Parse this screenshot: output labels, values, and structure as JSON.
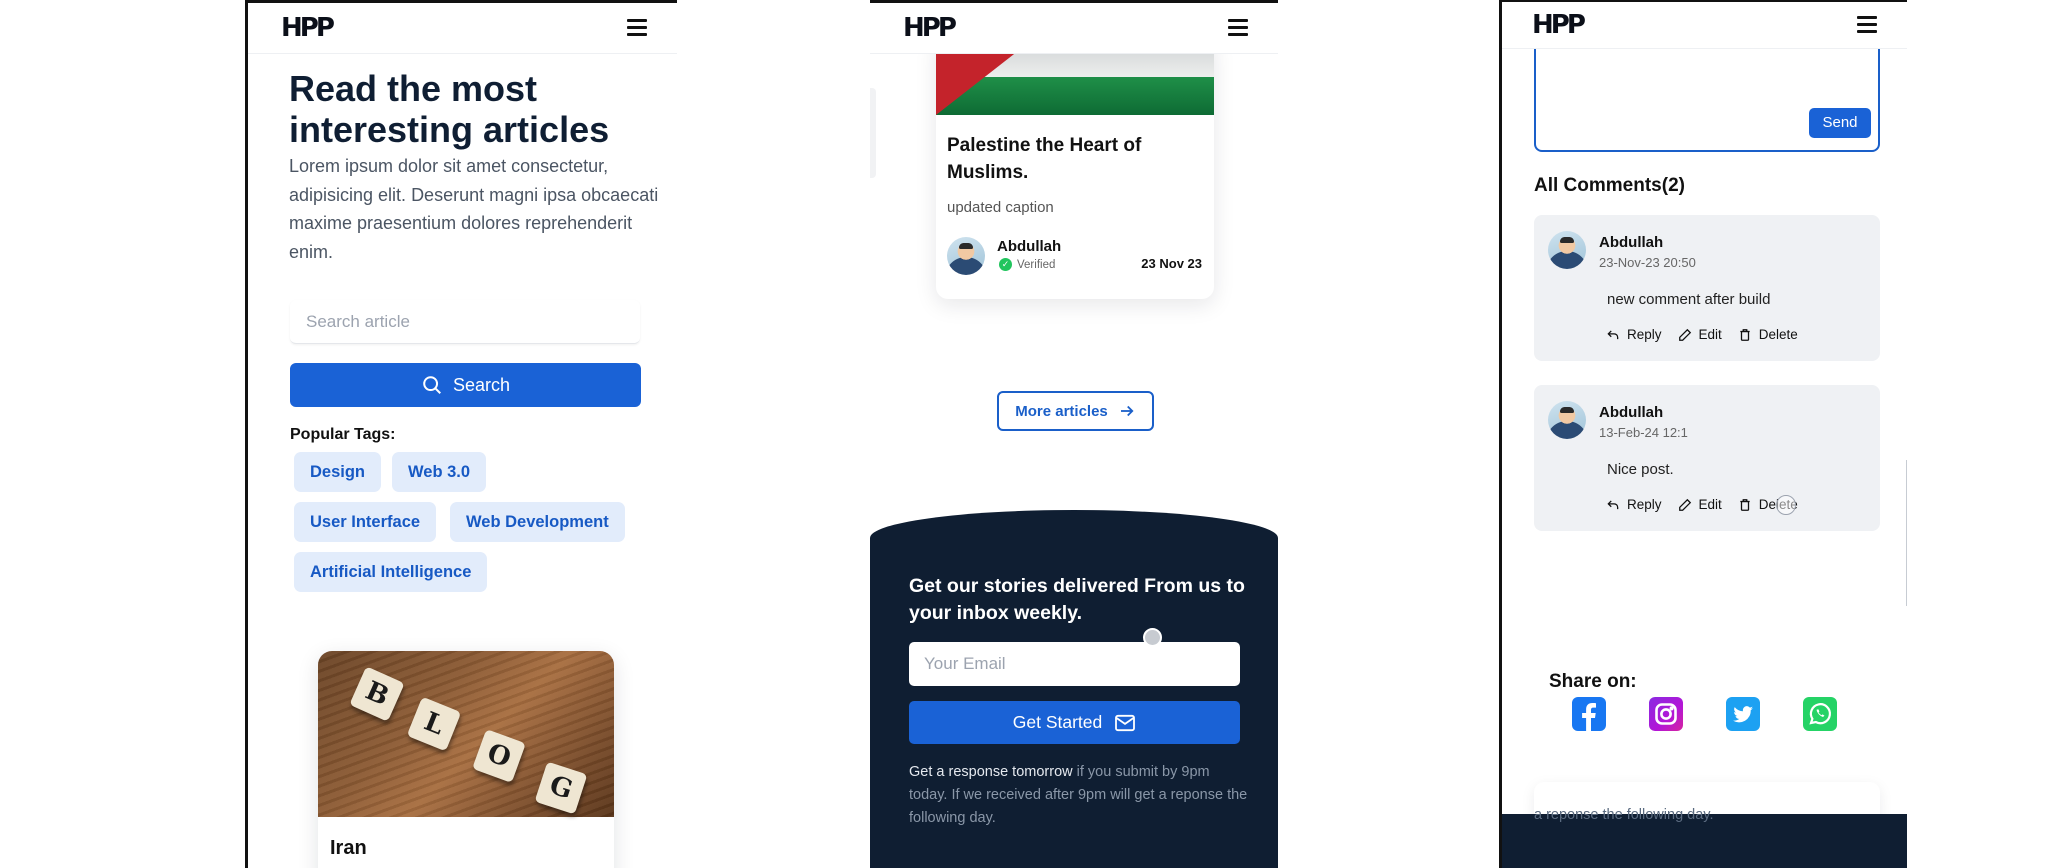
{
  "brand": {
    "logo": "HPP"
  },
  "screen1": {
    "hero_title": "Read the most interesting articles",
    "hero_subtitle": "Lorem ipsum dolor sit amet consectetur, adipisicing elit. Deserunt magni ipsa obcaecati maxime praesentium dolores reprehenderit enim.",
    "search": {
      "placeholder": "Search article",
      "button_label": "Search"
    },
    "tags_label": "Popular Tags:",
    "tags": [
      "Design",
      "Web 3.0",
      "User Interface",
      "Web Development",
      "Artificial Intelligence"
    ],
    "blog_tiles": [
      "B",
      "L",
      "O",
      "G"
    ],
    "article_title": "Iran"
  },
  "screen2": {
    "article": {
      "title": "Palestine the Heart of Muslims.",
      "caption": "updated caption",
      "author": "Abdullah",
      "verified_label": "Verified",
      "date": "23 Nov 23"
    },
    "more_articles_label": "More articles",
    "newsletter": {
      "title": "Get our stories delivered From us to your inbox weekly.",
      "email_placeholder": "Your Email",
      "button_label": "Get Started",
      "note_highlight": "Get a response tomorrow",
      "note_rest": " if you submit by 9pm today. If we received after 9pm will get a reponse the following day."
    }
  },
  "screen3": {
    "send_label": "Send",
    "comments_title": "All Comments(2)",
    "comments": [
      {
        "author": "Abdullah",
        "date": "23-Nov-23 20:50",
        "text": "new comment after build",
        "reply": "Reply",
        "edit": "Edit",
        "delete": "Delete"
      },
      {
        "author": "Abdullah",
        "date": "13-Feb-24 12:1",
        "text": "Nice post.",
        "reply": "Reply",
        "edit": "Edit",
        "delete": "Delete"
      }
    ],
    "share_label": "Share on:",
    "share_icons": [
      "facebook-icon",
      "instagram-icon",
      "twitter-icon",
      "whatsapp-icon"
    ],
    "footer_note_fragment": "a reponse the following day."
  },
  "colors": {
    "primary": "#1a62d6",
    "dark_footer": "#0f1e32",
    "tag_bg": "#e2ecfb",
    "tag_text": "#1759c4"
  }
}
